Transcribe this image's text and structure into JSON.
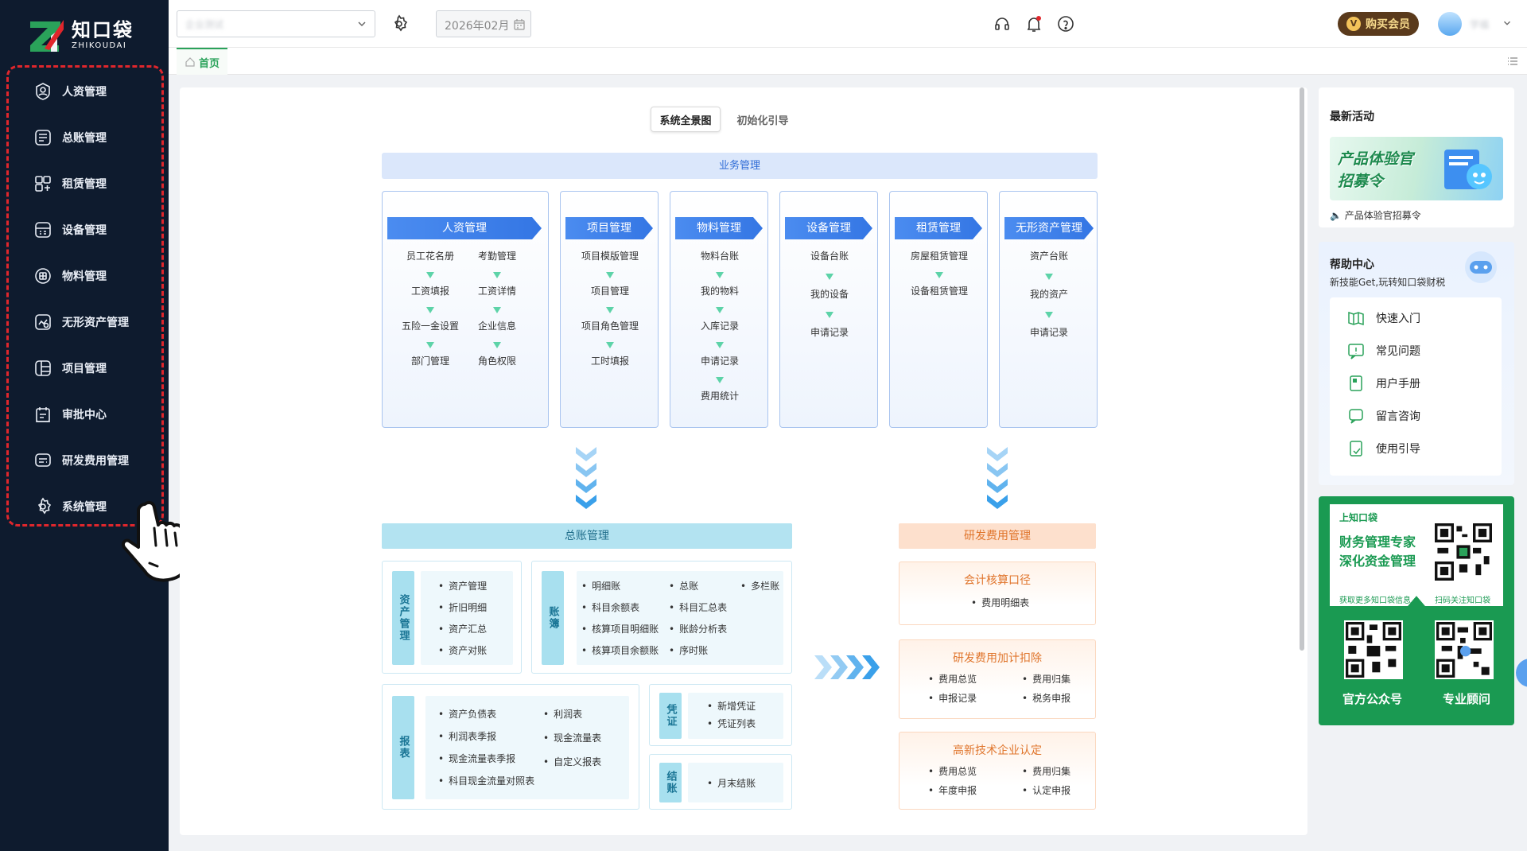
{
  "logo": {
    "cn": "知口袋",
    "en": "ZHIKOUDAI"
  },
  "sidebar": {
    "items": [
      {
        "label": "人资管理",
        "icon": "user-circle-icon"
      },
      {
        "label": "总账管理",
        "icon": "ledger-icon"
      },
      {
        "label": "租赁管理",
        "icon": "lease-icon"
      },
      {
        "label": "设备管理",
        "icon": "device-icon"
      },
      {
        "label": "物料管理",
        "icon": "material-icon"
      },
      {
        "label": "无形资产管理",
        "icon": "intangible-asset-icon"
      },
      {
        "label": "项目管理",
        "icon": "project-icon"
      },
      {
        "label": "审批中心",
        "icon": "approval-icon"
      },
      {
        "label": "研发费用管理",
        "icon": "rd-expense-icon"
      },
      {
        "label": "系统管理",
        "icon": "gear-icon"
      }
    ]
  },
  "topbar": {
    "company_value": "企业测试",
    "date_value": "2026年02月",
    "vip_label": "购买会员",
    "vip_badge": "V",
    "user_name": "学福"
  },
  "tabs": {
    "home": "首页"
  },
  "panel_tabs": {
    "overview": "系统全景图",
    "guide": "初始化引导"
  },
  "business": {
    "header": "业务管理",
    "modules": [
      {
        "title": "人资管理",
        "left": [
          "员工花名册",
          "工资填报",
          "五险一金设置",
          "部门管理"
        ],
        "right": [
          "考勤管理",
          "工资详情",
          "企业信息",
          "角色权限"
        ]
      },
      {
        "title": "项目管理",
        "items": [
          "项目模版管理",
          "项目管理",
          "项目角色管理",
          "工时填报"
        ]
      },
      {
        "title": "物料管理",
        "items": [
          "物料台账",
          "我的物料",
          "入库记录",
          "申请记录",
          "费用统计"
        ]
      },
      {
        "title": "设备管理",
        "items": [
          "设备台账",
          "我的设备",
          "申请记录"
        ]
      },
      {
        "title": "租赁管理",
        "items": [
          "房屋租赁管理",
          "设备租赁管理"
        ]
      },
      {
        "title": "无形资产管理",
        "items": [
          "资产台账",
          "我的资产",
          "申请记录"
        ]
      }
    ]
  },
  "gl": {
    "header": "总账管理",
    "assets": {
      "side": "资产管理",
      "items": [
        "资产管理",
        "折旧明细",
        "资产汇总",
        "资产对账"
      ]
    },
    "books": {
      "side": "账簿",
      "items": [
        "明细账",
        "科目余额表",
        "核算项目明细账",
        "核算项目余额账",
        "总账",
        "科目汇总表",
        "账龄分析表",
        "序时账",
        "多栏账"
      ]
    },
    "reports": {
      "side": "报表",
      "items": [
        "资产负债表",
        "利润表季报",
        "现金流量表季报",
        "科目现金流量对照表",
        "利润表",
        "现金流量表",
        "自定义报表"
      ]
    },
    "vouchers": {
      "side": "凭证",
      "items": [
        "新增凭证",
        "凭证列表"
      ]
    },
    "closing": {
      "side": "结账",
      "items": [
        "月末结账"
      ]
    }
  },
  "rd": {
    "header": "研发费用管理",
    "accounting": {
      "title": "会计核算口径",
      "items": [
        "费用明细表"
      ]
    },
    "deduction": {
      "title": "研发费用加计扣除",
      "items": [
        "费用总览",
        "费用归集",
        "申报记录",
        "税务申报"
      ]
    },
    "hightech": {
      "title": "高新技术企业认定",
      "items": [
        "费用总览",
        "费用归集",
        "年度申报",
        "认定申报"
      ]
    }
  },
  "right": {
    "activity": {
      "title": "最新活动",
      "banner_line1": "产品体验官",
      "banner_line2": "招募令",
      "caption": "产品体验官招募令"
    },
    "help": {
      "title": "帮助中心",
      "subtitle": "新技能Get,玩转知口袋财税",
      "items": [
        "快速入门",
        "常见问题",
        "用户手册",
        "留言咨询",
        "使用引导"
      ]
    },
    "qr": {
      "brand": "上知口袋",
      "slogan1": "财务管理专家",
      "slogan2": "深化资金管理",
      "more": "获取更多知口袋信息",
      "scan": "扫码关注知口袋",
      "official": "官方公众号",
      "advisor": "专业顾问"
    }
  },
  "colors": {
    "sidebar": "#0e1b2e",
    "accent": "#2aa25a",
    "highlight": "#e0262c",
    "biz_blue": "#3476e4"
  }
}
